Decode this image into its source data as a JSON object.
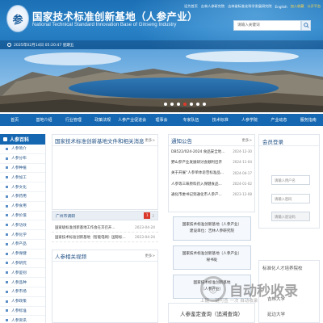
{
  "header": {
    "logo_char": "参",
    "title": "国家技术标准创新基地（人参产业）",
    "subtitle": "National Technical Standard Innovation Base of Ginseng Industry",
    "top_links": [
      "设为首页",
      "吉林人参研究院",
      "吉林省标准化科学发展研究院",
      "English",
      "加入收藏",
      "公开平台"
    ],
    "search_placeholder": "请输入关键词",
    "date": "2025年02月14日 05:20:47 星期五"
  },
  "banner": {
    "dot_count": 7,
    "active_dot": 3
  },
  "nav": [
    "首页",
    "基地介绍",
    "行业管理",
    "政策法规",
    "人参产业促进会",
    "理事会",
    "专家队伍",
    "技术标准",
    "人参学院",
    "产业动态",
    "服务指南"
  ],
  "sidebar": {
    "title": "人参百科",
    "items": [
      "人参简介",
      "人参分布",
      "人参种植",
      "人参加工",
      "人参文化",
      "人参药用",
      "人参食用",
      "人参价值",
      "人参功效",
      "人参化学",
      "人参产品",
      "人参保健",
      "人参研究",
      "人参鉴别",
      "人参品种",
      "人参市场",
      "人参政策",
      "人参标准",
      "人参资讯"
    ]
  },
  "documents": {
    "title": "国家技术标准创新基地文件和相关消息",
    "more": "更多>",
    "subheader": {
      "label": "广州市调研",
      "badge": "1",
      "extra": "2"
    },
    "rows": [
      {
        "title": "国家级标准创新基地工作会在京召开...",
        "date": "2023-04-24"
      },
      {
        "title": "国家技术标准创新基地（智能电网）国际标...",
        "date": "2023-04-24"
      }
    ]
  },
  "video": {
    "title": "人参相关视频",
    "more": "更多>"
  },
  "notice": {
    "title": "通知公告",
    "more": "更多>",
    "rows": [
      {
        "title": "DB522/024-2024 食品安全地...",
        "date": "2024-12-30"
      },
      {
        "title": "野山参产业发展研讨会顺利召开",
        "date": "2024-11-04"
      },
      {
        "title": "关于开展“人参单体皂苷标准品...",
        "date": "2024-04-17"
      },
      {
        "title": "人参等三味原料药入保健食品...",
        "date": "2024-01-02"
      },
      {
        "title": "通化市委书记到通化市人参产...",
        "date": "2023-12-08"
      }
    ]
  },
  "info_boxes": [
    {
      "line1": "国家技术标准创新基地（人参产业）",
      "line2": "建设单位：吉林人参研究院"
    },
    {
      "line1": "国家技术标准创新基地（人参产业）",
      "line2": "秘书处"
    },
    {
      "line1": "国家技术标准创新基地",
      "line2": "（人参产业）"
    }
  ],
  "member": {
    "title": "会员登录",
    "username_placeholder": "请输入用户名",
    "password_placeholder": "请输入密码",
    "captcha_placeholder": "请输入验证码"
  },
  "right_lower": {
    "line1": "标准化人才培养院校",
    "line2": "吉林大学",
    "line3": "延边大学"
  },
  "watermark": {
    "text": "自动秒收录",
    "sub": "上链 一键可查 一次 自动收录"
  },
  "footer_box": {
    "label": "人参鉴定查询（追溯查询）"
  },
  "colors": {
    "header_blue": "#1b6fb4",
    "nav_blue": "#1567b1",
    "accent_red": "#d9382a"
  }
}
